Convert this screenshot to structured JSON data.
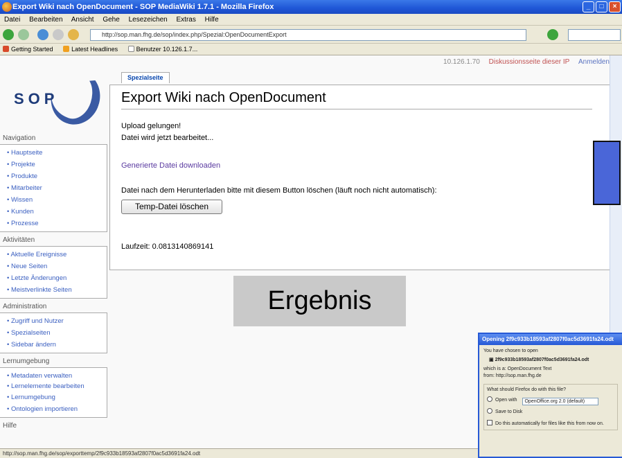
{
  "window": {
    "title": "Export Wiki nach OpenDocument - SOP MediaWiki 1.7.1 - Mozilla Firefox"
  },
  "menu": [
    "Datei",
    "Bearbeiten",
    "Ansicht",
    "Gehe",
    "Lesezeichen",
    "Extras",
    "Hilfe"
  ],
  "url": "http://sop.man.fhg.de/sop/index.php/Spezial:OpenDocumentExport",
  "bookmarks": [
    "Getting Started",
    "Latest Headlines",
    "Benutzer 10.126.1.7..."
  ],
  "user_bar": {
    "ip": "10.126.1.70",
    "talk": "Diskussionsseite dieser IP",
    "login": "Anmelden"
  },
  "logo": {
    "text": "SOP"
  },
  "sidebar": {
    "nav_title": "Navigation",
    "nav": [
      "Hauptseite",
      "Projekte",
      "Produkte",
      "Mitarbeiter",
      "Wissen",
      "Kunden",
      "Prozesse"
    ],
    "act_title": "Aktivitäten",
    "act": [
      "Aktuelle Ereignisse",
      "Neue Seiten",
      "Letzte Änderungen",
      "Meistverlinkte Seiten"
    ],
    "admin_title": "Administration",
    "admin": [
      "Zugriff und Nutzer",
      "Spezialseiten",
      "Sidebar ändern"
    ],
    "learn_title": "Lernumgebung",
    "learn": [
      "Metadaten verwalten",
      "Lernelemente bearbeiten",
      "Lernumgebung",
      "Ontologien importieren"
    ],
    "help_title": "Hilfe"
  },
  "tab_label": "Spezialseite",
  "page_title": "Export Wiki nach OpenDocument",
  "messages": {
    "upload": "Upload gelungen!",
    "processing": "Datei wird jetzt bearbeitet...",
    "download_link": "Generierte Datei downloaden",
    "delete_hint": "Datei nach dem Herunterladen bitte mit diesem Button löschen (läuft noch nicht automatisch):",
    "delete_button": "Temp-Datei löschen",
    "runtime": "Laufzeit: 0.0813140869141"
  },
  "overlay_label": "Ergebnis",
  "status_text": "http://sop.man.fhg.de/sop/exporttemp/2f9c933b18593af2807f0ac5d3691fa24.odt",
  "dialog": {
    "title": "Opening 2f9c933b18593af2807f0ac5d3691fa24.odt",
    "chosen": "You have chosen to open",
    "filename": "2f9c933b18593af2807f0ac5d3691fa24.odt",
    "which_is": "which is a: OpenDocument Text",
    "from": "from: http://sop.man.fhg.de",
    "question": "What should Firefox do with this file?",
    "open_with": "Open with",
    "app": "OpenOffice.org 2.0 (default)",
    "save": "Save to Disk",
    "auto": "Do this automatically for files like this from now on."
  },
  "colors": {
    "link": "#3a5fc0",
    "titlebar": "#1f56d6",
    "overlay_bg": "#c9c9c9",
    "accent_box": "#4a66d8"
  }
}
